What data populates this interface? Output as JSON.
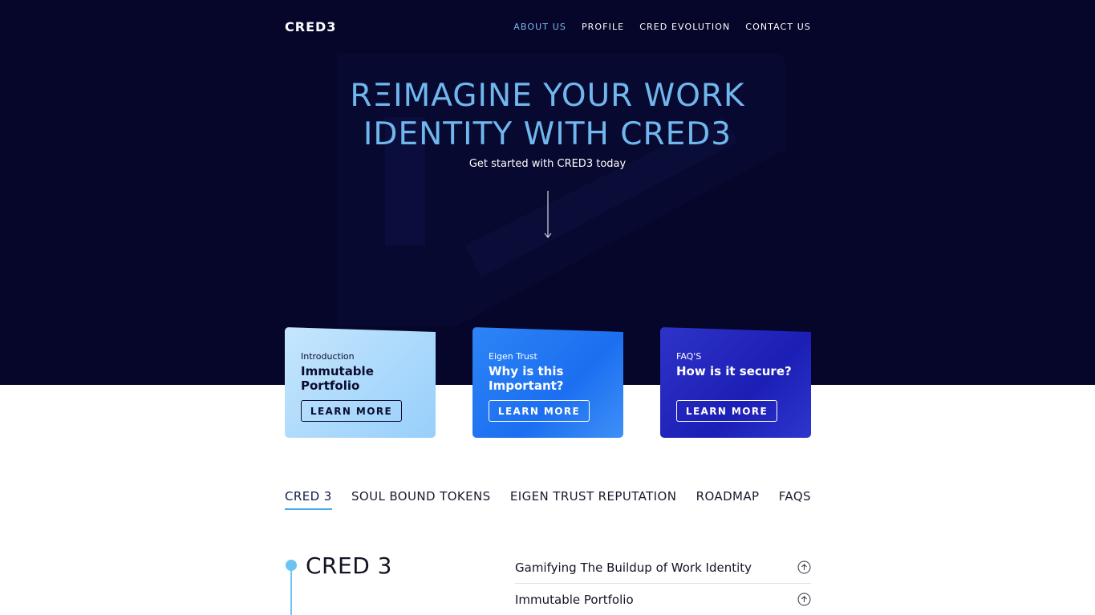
{
  "nav": {
    "logo": "CRED3",
    "links": [
      {
        "label": "ABOUT US",
        "active": true
      },
      {
        "label": "PROFILE",
        "active": false
      },
      {
        "label": "CRED EVOLUTION",
        "active": false
      },
      {
        "label": "CONTACT US",
        "active": false
      }
    ]
  },
  "hero": {
    "headline_line1": "RΞIMAGINE YOUR WORK",
    "headline_line2": "IDENTITY WITH CRED3",
    "subline": "Get started with CRED3 today"
  },
  "cards": [
    {
      "kicker": "Introduction",
      "title_line1": "Immutable",
      "title_line2": "Portfolio",
      "button": "LEARN MORE"
    },
    {
      "kicker": "Eigen Trust",
      "title_line1": "Why is this",
      "title_line2": "Important?",
      "button": "LEARN MORE"
    },
    {
      "kicker": "FAQ'S",
      "title_line1": "How is it secure?",
      "title_line2": "",
      "button": "LEARN MORE"
    }
  ],
  "tabs": [
    {
      "label": "CRED 3",
      "active": true
    },
    {
      "label": "SOUL BOUND TOKENS",
      "active": false
    },
    {
      "label": "EIGEN TRUST REPUTATION",
      "active": false
    },
    {
      "label": "ROADMAP",
      "active": false
    },
    {
      "label": "FAQS",
      "active": false
    }
  ],
  "section": {
    "title": "CRED 3",
    "accordion": [
      {
        "label": "Gamifying The Buildup of Work Identity",
        "icon": "arrow-up-circle-icon"
      },
      {
        "label": "Immutable Portfolio",
        "icon": "arrow-up-circle-icon"
      }
    ]
  },
  "colors": {
    "hero_bg": "#05062a",
    "headline": "#70b7ee",
    "accent": "#4aa8ee",
    "card1": "#b4dcfc",
    "card2": "#2379f3",
    "card3": "#2226bd"
  }
}
